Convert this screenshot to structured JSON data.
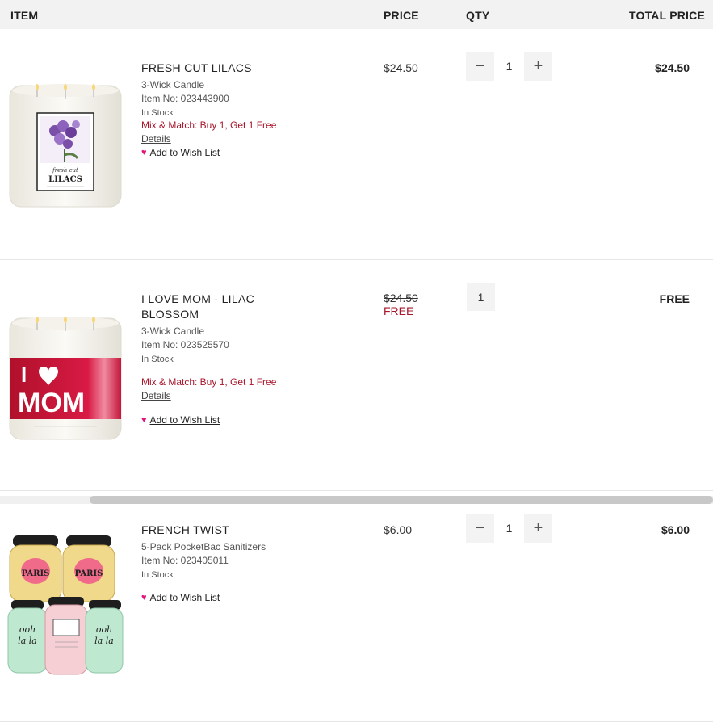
{
  "header": {
    "item": "ITEM",
    "price": "PRICE",
    "qty": "QTY",
    "total": "TOTAL PRICE"
  },
  "items": [
    {
      "name": "FRESH CUT LILACS",
      "type": "3-Wick Candle",
      "item_no": "Item No: 023443900",
      "stock": "In Stock",
      "promo": "Mix & Match: Buy 1, Get 1 Free",
      "details": "Details",
      "wish": "Add to Wish List",
      "price": "$24.50",
      "qty": "1",
      "total": "$24.50",
      "image_label_top": "fresh cut",
      "image_label_main": "LILACS"
    },
    {
      "name": "I LOVE MOM - LILAC BLOSSOM",
      "type": "3-Wick Candle",
      "item_no": "Item No: 023525570",
      "stock": "In Stock",
      "promo": "Mix & Match: Buy 1, Get 1 Free",
      "details": "Details",
      "wish": "Add to Wish List",
      "original_price": "$24.50",
      "sale_price": "FREE",
      "qty": "1",
      "total": "FREE",
      "image_label_i": "I",
      "image_label_main": "MOM"
    },
    {
      "name": "FRENCH TWIST",
      "type": "5-Pack PocketBac Sanitizers",
      "item_no": "Item No: 023405011",
      "stock": "In Stock",
      "wish": "Add to Wish List",
      "price": "$6.00",
      "qty": "1",
      "total": "$6.00"
    }
  ],
  "stepper": {
    "minus": "−",
    "plus": "+"
  },
  "icons": {
    "heart": "heart-icon",
    "minus": "minus-icon",
    "plus": "plus-icon"
  },
  "colors": {
    "promo_red": "#a8162b",
    "heart_pink": "#e0147a",
    "header_bg": "#f2f2f2"
  }
}
